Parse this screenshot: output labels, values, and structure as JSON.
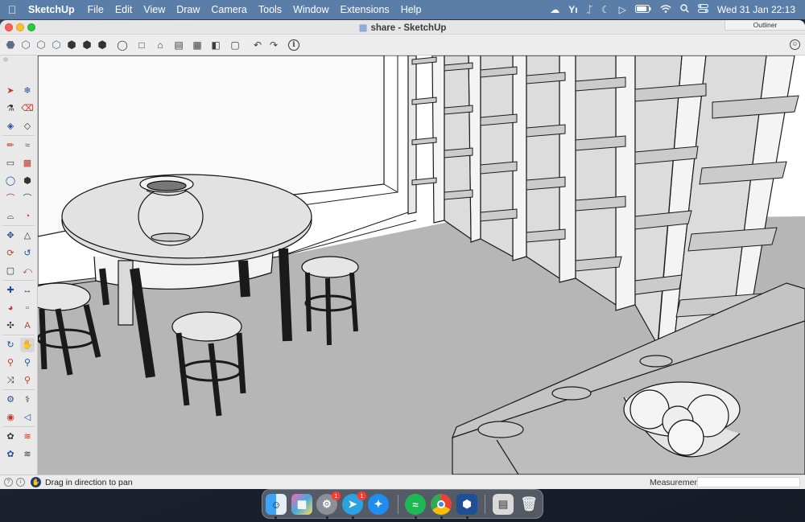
{
  "menubar": {
    "apple_icon": "apple-logo",
    "app_name": "SketchUp",
    "menus": [
      "File",
      "Edit",
      "View",
      "Draw",
      "Camera",
      "Tools",
      "Window",
      "Extensions",
      "Help"
    ],
    "status_icons": [
      "creative-cloud-icon",
      "y-app-icon",
      "bluetooth-icon",
      "moon-icon",
      "play-icon",
      "battery-icon",
      "wifi-icon",
      "search-icon",
      "control-center-icon"
    ],
    "clock": "Wed 31 Jan  22:13"
  },
  "window": {
    "title": "share - SketchUp",
    "outliner_label": "Outliner"
  },
  "toolbar": {
    "buttons": [
      "iso-view",
      "top-view",
      "front-view",
      "right-view",
      "back-view",
      "left-view",
      "bottom-view",
      "perspective",
      "parallel",
      "house",
      "section-plane",
      "section-cut",
      "display-section",
      "section-fill",
      "undo",
      "redo",
      "info"
    ],
    "info_glyph": "i"
  },
  "palette": {
    "tools": [
      "select",
      "lasso",
      "paint-bucket",
      "eraser",
      "tag",
      "eraser-2",
      "line",
      "freehand",
      "rectangle",
      "rotated-rectangle",
      "circle",
      "polygon",
      "arc",
      "two-point-arc",
      "three-point-arc",
      "pie",
      "move",
      "push-pull",
      "rotate",
      "follow-me",
      "scale",
      "offset",
      "tape-measure",
      "dimension",
      "protractor",
      "text",
      "axes",
      "3d-text",
      "orbit",
      "pan",
      "zoom",
      "zoom-window",
      "zoom-extents",
      "previous",
      "position-camera",
      "walk",
      "look-around",
      "section-plane",
      "sandbox-1",
      "sandbox-2",
      "sandbox-3",
      "sandbox-4"
    ]
  },
  "statusbar": {
    "message": "Drag in direction to pan",
    "measurements_label": "Measurements",
    "measurements_value": ""
  },
  "dock": {
    "apps": [
      {
        "name": "Finder",
        "badge": ""
      },
      {
        "name": "Launchpad",
        "badge": ""
      },
      {
        "name": "System Settings",
        "badge": "1"
      },
      {
        "name": "Telegram",
        "badge": "1"
      },
      {
        "name": "Safari",
        "badge": ""
      },
      {
        "name": "Spotify",
        "badge": ""
      },
      {
        "name": "Chrome",
        "badge": ""
      },
      {
        "name": "SketchUp",
        "badge": ""
      },
      {
        "name": "Screenshot",
        "badge": ""
      },
      {
        "name": "Trash",
        "badge": ""
      }
    ]
  },
  "colors": {
    "menubar_bg": "#5b7ea8",
    "floor": "#b5b5b5",
    "shelf": "#cbcbcb"
  }
}
